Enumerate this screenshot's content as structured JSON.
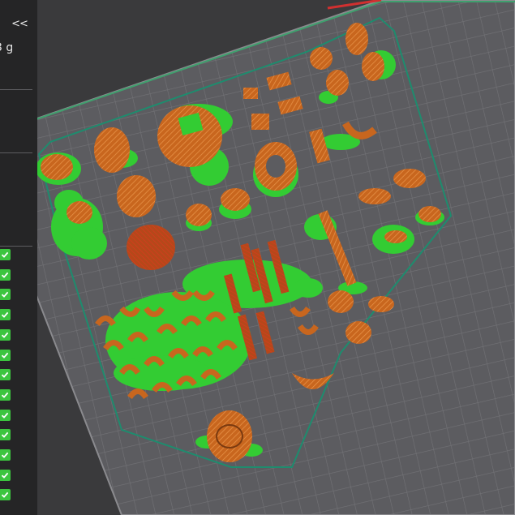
{
  "panel": {
    "collapse_label": "<<",
    "weight_text": "3 g",
    "dot_mark": "·",
    "object_checks": [
      true,
      true,
      true,
      true,
      true,
      true,
      true,
      true,
      true,
      true,
      true,
      true,
      true
    ]
  },
  "colors": {
    "background": "#3a3a3c",
    "plate_grid": "#6a6a6e",
    "plate_border": "#8a8a8e",
    "object_orange": "#c8661e",
    "object_highlight": "#e8944a",
    "support_green": "#33cc33",
    "hull_outline": "#1e8c6e",
    "panel_bg": "#252526",
    "check_green": "#3cc53f"
  }
}
